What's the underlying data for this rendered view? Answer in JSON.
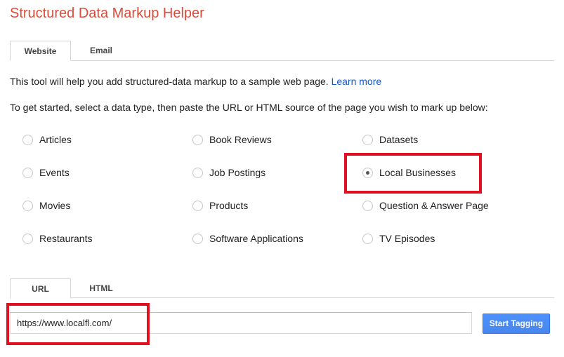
{
  "page": {
    "title": "Structured Data Markup Helper"
  },
  "top_tabs": [
    {
      "label": "Website",
      "active": true
    },
    {
      "label": "Email",
      "active": false
    }
  ],
  "intro": {
    "text": "This tool will help you add structured-data markup to a sample web page.",
    "learn_more": "Learn more"
  },
  "instructions": "To get started, select a data type, then paste the URL or HTML source of the page you wish to mark up below:",
  "data_types": [
    {
      "label": "Articles",
      "checked": false
    },
    {
      "label": "Book Reviews",
      "checked": false
    },
    {
      "label": "Datasets",
      "checked": false
    },
    {
      "label": "Events",
      "checked": false
    },
    {
      "label": "Job Postings",
      "checked": false
    },
    {
      "label": "Local Businesses",
      "checked": true
    },
    {
      "label": "Movies",
      "checked": false
    },
    {
      "label": "Products",
      "checked": false
    },
    {
      "label": "Question & Answer Page",
      "checked": false
    },
    {
      "label": "Restaurants",
      "checked": false
    },
    {
      "label": "Software Applications",
      "checked": false
    },
    {
      "label": "TV Episodes",
      "checked": false
    }
  ],
  "source_tabs": [
    {
      "label": "URL",
      "active": true
    },
    {
      "label": "HTML",
      "active": false
    }
  ],
  "url_input": {
    "value": "https://www.localfl.com/"
  },
  "start_button": {
    "label": "Start Tagging"
  },
  "colors": {
    "title": "#dd4b39",
    "link": "#1155cc",
    "highlight": "#e0101e",
    "button": "#4d90fe"
  }
}
